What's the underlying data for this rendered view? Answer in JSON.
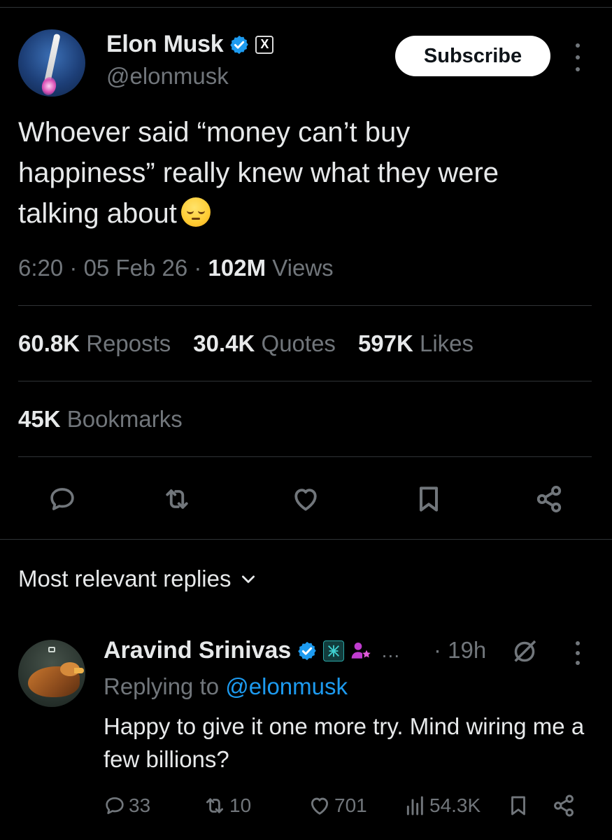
{
  "tweet": {
    "author_name": "Elon Musk",
    "handle": "@elonmusk",
    "subscribe_label": "Subscribe",
    "text": "Whoever said “money can’t buy\nhappiness” really knew what they were\ntalking about",
    "emoji": "pensive-face",
    "time": "6:20",
    "date": "05 Feb 26",
    "views_count": "102M",
    "views_label": "Views",
    "separator": " · ",
    "reposts_count": "60.8K",
    "reposts_label": "Reposts",
    "quotes_count": "30.4K",
    "quotes_label": "Quotes",
    "likes_count": "597K",
    "likes_label": "Likes",
    "bookmarks_count": "45K",
    "bookmarks_label": "Bookmarks",
    "verified_color": "#1d9bf0",
    "affiliation_badge": "X"
  },
  "actions": [
    "reply-icon",
    "repost-icon",
    "like-icon",
    "bookmark-icon",
    "share-icon"
  ],
  "replies_header": "Most relevant replies",
  "reply": {
    "author_name": "Aravind Srinivas",
    "ellipsis": "…",
    "time": "· 19h",
    "replying_prefix": "Replying to ",
    "replying_to": "@elonmusk",
    "text": "Happy to give it one more try. Mind wiring me a few billions?",
    "reply_count": "33",
    "repost_count": "10",
    "like_count": "701",
    "view_count": "54.3K"
  },
  "colors": {
    "background": "#000000",
    "text": "#e7e9ea",
    "muted": "#71767b",
    "accent": "#1d9bf0",
    "divider": "#2f3336"
  }
}
